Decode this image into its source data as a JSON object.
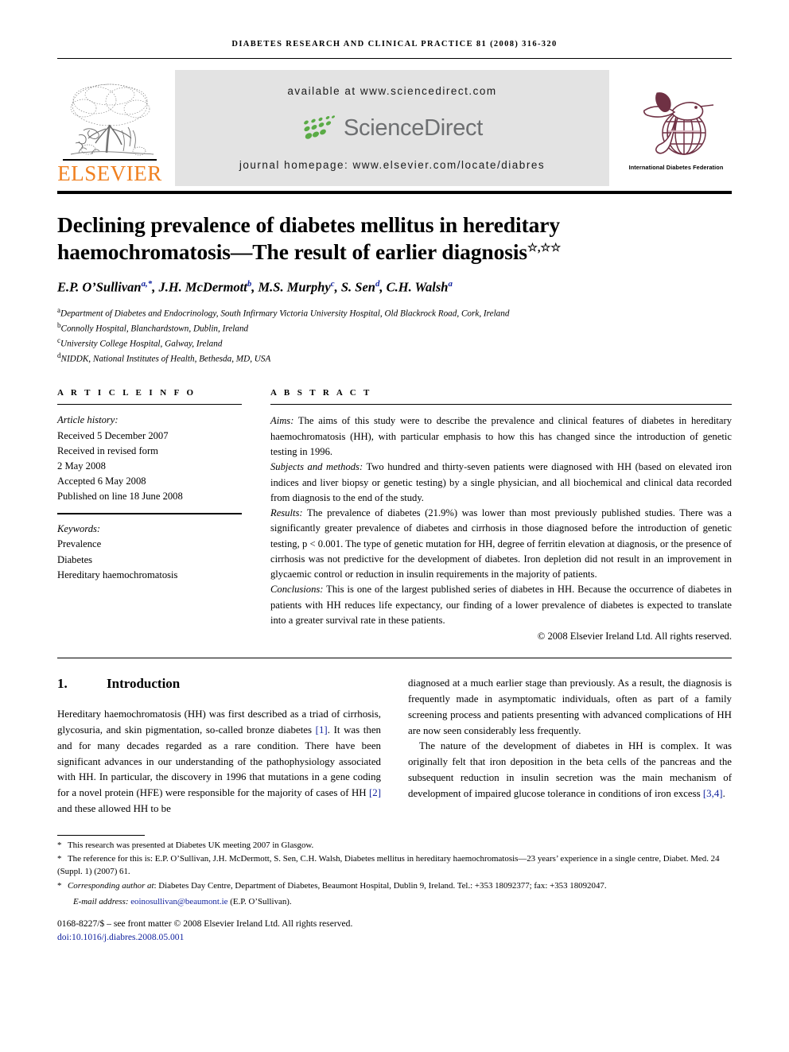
{
  "running_head": "DIABETES RESEARCH AND CLINICAL PRACTICE 81 (2008) 316-320",
  "masthead": {
    "publisher_name": "ELSEVIER",
    "publisher_color": "#F08020",
    "available_at": "available at www.sciencedirect.com",
    "sciencedirect_wordmark": "ScienceDirect",
    "sciencedirect_text_color": "#6d6f71",
    "sciencedirect_leaf_color": "#5aab46",
    "journal_homepage": "journal homepage: www.elsevier.com/locate/diabres",
    "banner_bg": "#e3e3e3",
    "idf_caption": "International Diabetes Federation",
    "idf_color": "#6f3144"
  },
  "article": {
    "title_line1": "Declining prevalence of diabetes mellitus in hereditary",
    "title_line2": "haemochromatosis—The result of earlier diagnosis",
    "title_footnote_marks": "☆,☆☆",
    "authors": [
      {
        "name": "E.P. O’Sullivan",
        "sup": "a,*"
      },
      {
        "name": "J.H. McDermott",
        "sup": "b"
      },
      {
        "name": "M.S. Murphy",
        "sup": "c"
      },
      {
        "name": "S. Sen",
        "sup": "d"
      },
      {
        "name": "C.H. Walsh",
        "sup": "a"
      }
    ],
    "affiliations": [
      {
        "label": "a",
        "text": "Department of Diabetes and Endocrinology, South Infirmary Victoria University Hospital, Old Blackrock Road, Cork, Ireland"
      },
      {
        "label": "b",
        "text": "Connolly Hospital, Blanchardstown, Dublin, Ireland"
      },
      {
        "label": "c",
        "text": "University College Hospital, Galway, Ireland"
      },
      {
        "label": "d",
        "text": "NIDDK, National Institutes of Health, Bethesda, MD, USA"
      }
    ]
  },
  "article_info": {
    "heading": "A R T I C L E    I N F O",
    "history_label": "Article history:",
    "history": [
      "Received 5 December 2007",
      "Received in revised form",
      "2 May 2008",
      "Accepted 6 May 2008",
      "Published on line 18 June 2008"
    ],
    "keywords_label": "Keywords:",
    "keywords": [
      "Prevalence",
      "Diabetes",
      "Hereditary haemochromatosis"
    ]
  },
  "abstract": {
    "heading": "A B S T R A C T",
    "sections": [
      {
        "lead": "Aims:",
        "text": " The aims of this study were to describe the prevalence and clinical features of diabetes in hereditary haemochromatosis (HH), with particular emphasis to how this has changed since the introduction of genetic testing in 1996."
      },
      {
        "lead": "Subjects and methods:",
        "text": " Two hundred and thirty-seven patients were diagnosed with HH (based on elevated iron indices and liver biopsy or genetic testing) by a single physician, and all biochemical and clinical data recorded from diagnosis to the end of the study."
      },
      {
        "lead": "Results:",
        "text": " The prevalence of diabetes (21.9%) was lower than most previously published studies. There was a significantly greater prevalence of diabetes and cirrhosis in those diagnosed before the introduction of genetic testing, p < 0.001. The type of genetic mutation for HH, degree of ferritin elevation at diagnosis, or the presence of cirrhosis was not predictive for the development of diabetes. Iron depletion did not result in an improvement in glycaemic control or reduction in insulin requirements in the majority of patients."
      },
      {
        "lead": "Conclusions:",
        "text": " This is one of the largest published series of diabetes in HH. Because the occurrence of diabetes in patients with HH reduces life expectancy, our finding of a lower prevalence of diabetes is expected to translate into a greater survival rate in these patients."
      }
    ],
    "copyright": "© 2008 Elsevier Ireland Ltd. All rights reserved."
  },
  "body": {
    "section_number": "1.",
    "section_title": "Introduction",
    "left_paragraph_parts": {
      "p1a": "Hereditary haemochromatosis (HH) was first described as a triad of cirrhosis, glycosuria, and skin pigmentation, so-called bronze diabetes ",
      "cite1": "[1]",
      "p1b": ". It was then and for many decades regarded as a rare condition. There have been significant advances in our understanding of the pathophysiology associated with HH. In particular, the discovery in 1996 that mutations in a gene coding for a novel protein (HFE) were responsible for the majority of cases of HH ",
      "cite2": "[2]",
      "p1c": " and these allowed HH to be"
    },
    "right_paragraph_1": "diagnosed at a much earlier stage than previously. As a result, the diagnosis is frequently made in asymptomatic individuals, often as part of a family screening process and patients presenting with advanced complications of HH are now seen considerably less frequently.",
    "right_paragraph_2_parts": {
      "p2a": "The nature of the development of diabetes in HH is complex. It was originally felt that iron deposition in the beta cells of the pancreas and the subsequent reduction in insulin secretion was the main mechanism of development of impaired glucose tolerance in conditions of iron excess ",
      "cite34": "[3,4]",
      "p2b": "."
    }
  },
  "footnotes": {
    "note1": "This research was presented at Diabetes UK meeting 2007 in Glasgow.",
    "note2": "The reference for this is: E.P. O’Sullivan, J.H. McDermott, S. Sen, C.H. Walsh, Diabetes mellitus in hereditary haemochromatosis—23 years’ experience in a single centre, Diabet. Med. 24 (Suppl. 1) (2007) 61.",
    "note3_lead": "Corresponding author at",
    "note3": ": Diabetes Day Centre, Department of Diabetes, Beaumont Hospital, Dublin 9, Ireland. Tel.: +353 18092377; fax: +353 18092047.",
    "email_label": "E-mail address:",
    "email": "eoinosullivan@beaumont.ie",
    "email_owner": "(E.P. O’Sullivan)."
  },
  "imprint": {
    "issn_line": "0168-8227/$ – see front matter © 2008 Elsevier Ireland Ltd. All rights reserved.",
    "doi": "doi:10.1016/j.diabres.2008.05.001"
  }
}
